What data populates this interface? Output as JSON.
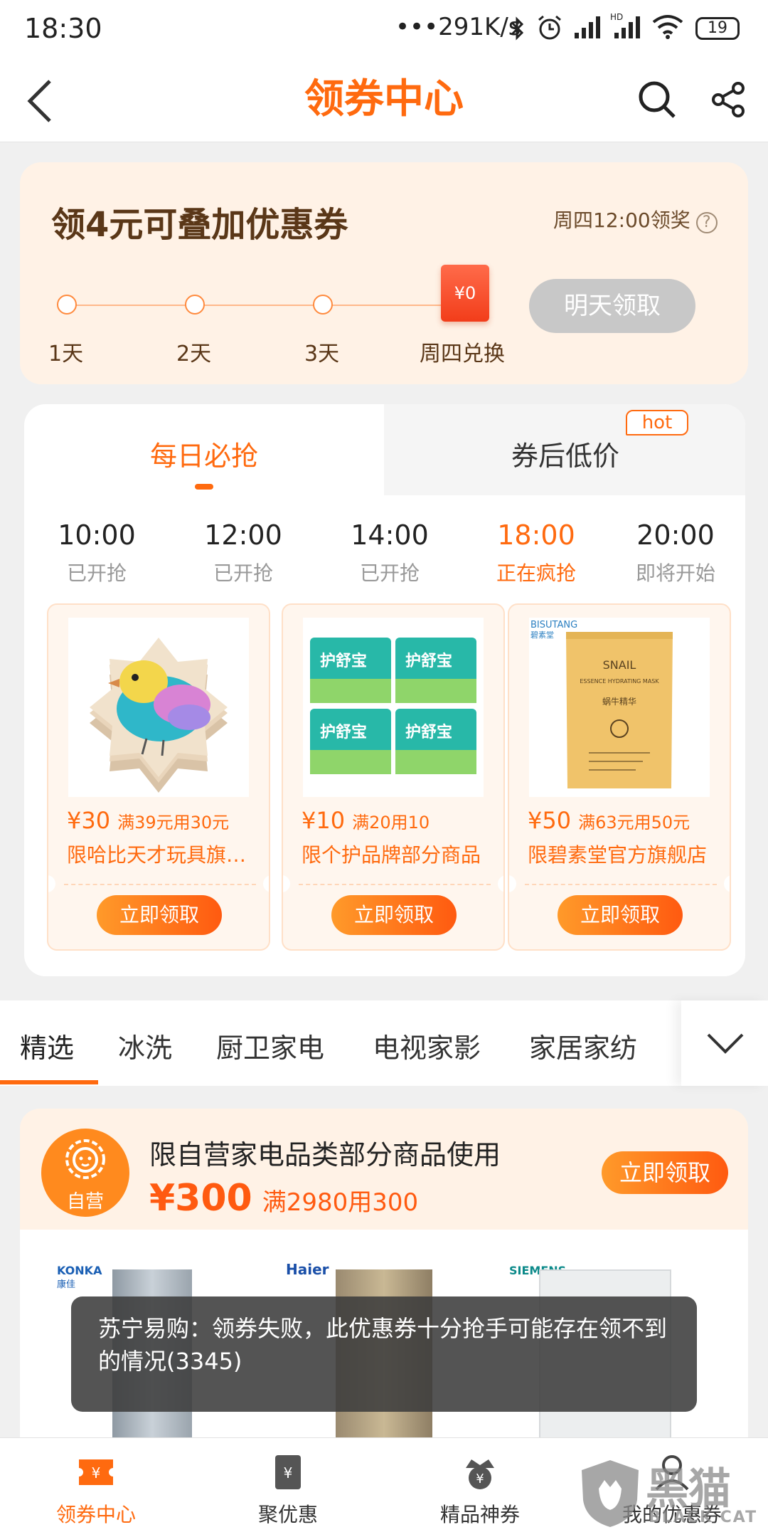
{
  "status_bar": {
    "time": "18:30",
    "network_speed": "•••291K/s",
    "battery": "19"
  },
  "nav": {
    "title": "领券中心"
  },
  "stacking": {
    "title": "领4元可叠加优惠券",
    "reward_time": "周四12:00领奖",
    "help": "?",
    "steps": [
      "1天",
      "2天",
      "3天",
      "周四兑换"
    ],
    "red_packet": "¥0",
    "claim_button": "明天领取"
  },
  "flash": {
    "tabs": [
      {
        "label": "每日必抢"
      },
      {
        "label": "券后低价"
      }
    ],
    "hot_badge": "hot",
    "slots": [
      {
        "time": "10:00",
        "status": "已开抢"
      },
      {
        "time": "12:00",
        "status": "已开抢"
      },
      {
        "time": "14:00",
        "status": "已开抢"
      },
      {
        "time": "18:00",
        "status": "正在疯抢"
      },
      {
        "time": "20:00",
        "status": "即将开始"
      }
    ],
    "coupons": [
      {
        "amount": "¥30",
        "condition": "满39元用30元",
        "desc": "限哈比天才玩具旗舰店",
        "button": "立即领取"
      },
      {
        "amount": "¥10",
        "condition": "满20用10",
        "desc": "限个护品牌部分商品",
        "button": "立即领取"
      },
      {
        "amount": "¥50",
        "condition": "满63元用50元",
        "desc": "限碧素堂官方旗舰店",
        "button": "立即领取"
      }
    ],
    "product_labels": {
      "pad_brand": "护舒宝",
      "mask_brand": "BISUTANG",
      "mask_brand_cn": "碧素堂",
      "mask_name": "SNAIL",
      "mask_sub": "ESSENCE HYDRATING MASK",
      "mask_cn": "蜗牛精华"
    }
  },
  "categories": {
    "items": [
      "精选",
      "冰洗",
      "厨卫家电",
      "电视家影",
      "家居家纺"
    ]
  },
  "promo": {
    "logo_label": "自营",
    "title": "限自营家电品类部分商品使用",
    "amount": "¥300",
    "condition": "满2980用300",
    "button": "立即领取",
    "brands": [
      "KONKA",
      "康佳",
      "Haier",
      "SIEMENS"
    ]
  },
  "toast": {
    "text": "苏宁易购：领券失败，此优惠券十分抢手可能存在领不到的情况(3345)"
  },
  "tabbar": {
    "items": [
      {
        "label": "领券中心"
      },
      {
        "label": "聚优惠"
      },
      {
        "label": "精品神券"
      },
      {
        "label": "我的优惠券"
      }
    ]
  },
  "watermark": {
    "cn": "黑猫",
    "en": "BLACK CAT"
  },
  "colors": {
    "accent": "#ff6a0f",
    "card_bg": "#fff2e6",
    "disabled": "#c8c8c8"
  }
}
